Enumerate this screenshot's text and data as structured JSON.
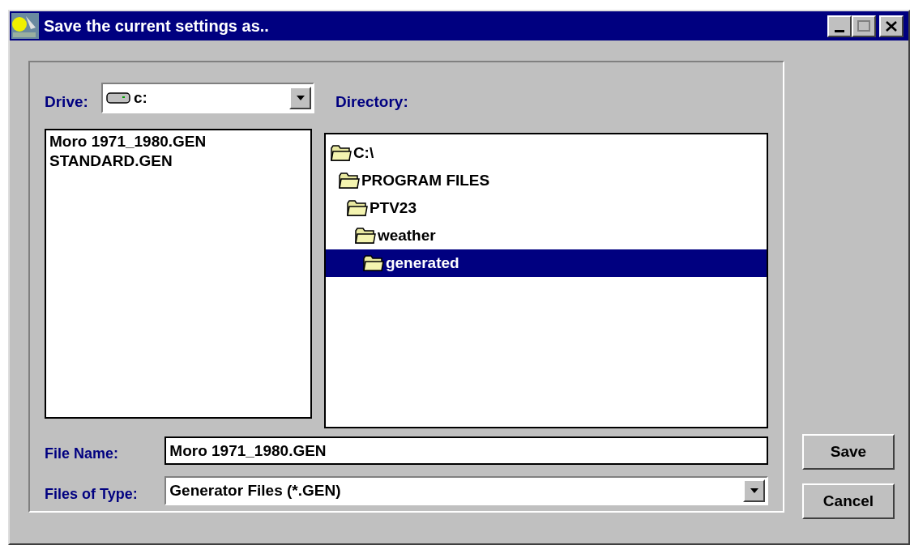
{
  "window": {
    "title": "Save the current settings as.."
  },
  "drive": {
    "label": "Drive:",
    "value": "c:"
  },
  "directory": {
    "label": "Directory:",
    "tree": [
      {
        "name": "C:\\",
        "selected": false,
        "children": [
          {
            "name": "PROGRAM FILES",
            "selected": false,
            "children": [
              {
                "name": "PTV23",
                "selected": false,
                "children": [
                  {
                    "name": "weather",
                    "selected": false,
                    "children": [
                      {
                        "name": "generated",
                        "selected": true
                      }
                    ]
                  }
                ]
              }
            ]
          }
        ]
      }
    ]
  },
  "files": [
    "Moro 1971_1980.GEN",
    "STANDARD.GEN"
  ],
  "file_name": {
    "label": "File Name:",
    "value": "Moro 1971_1980.GEN"
  },
  "files_of_type": {
    "label": "Files of Type:",
    "value": "Generator Files (*.GEN)"
  },
  "buttons": [
    "Save",
    "Cancel"
  ]
}
